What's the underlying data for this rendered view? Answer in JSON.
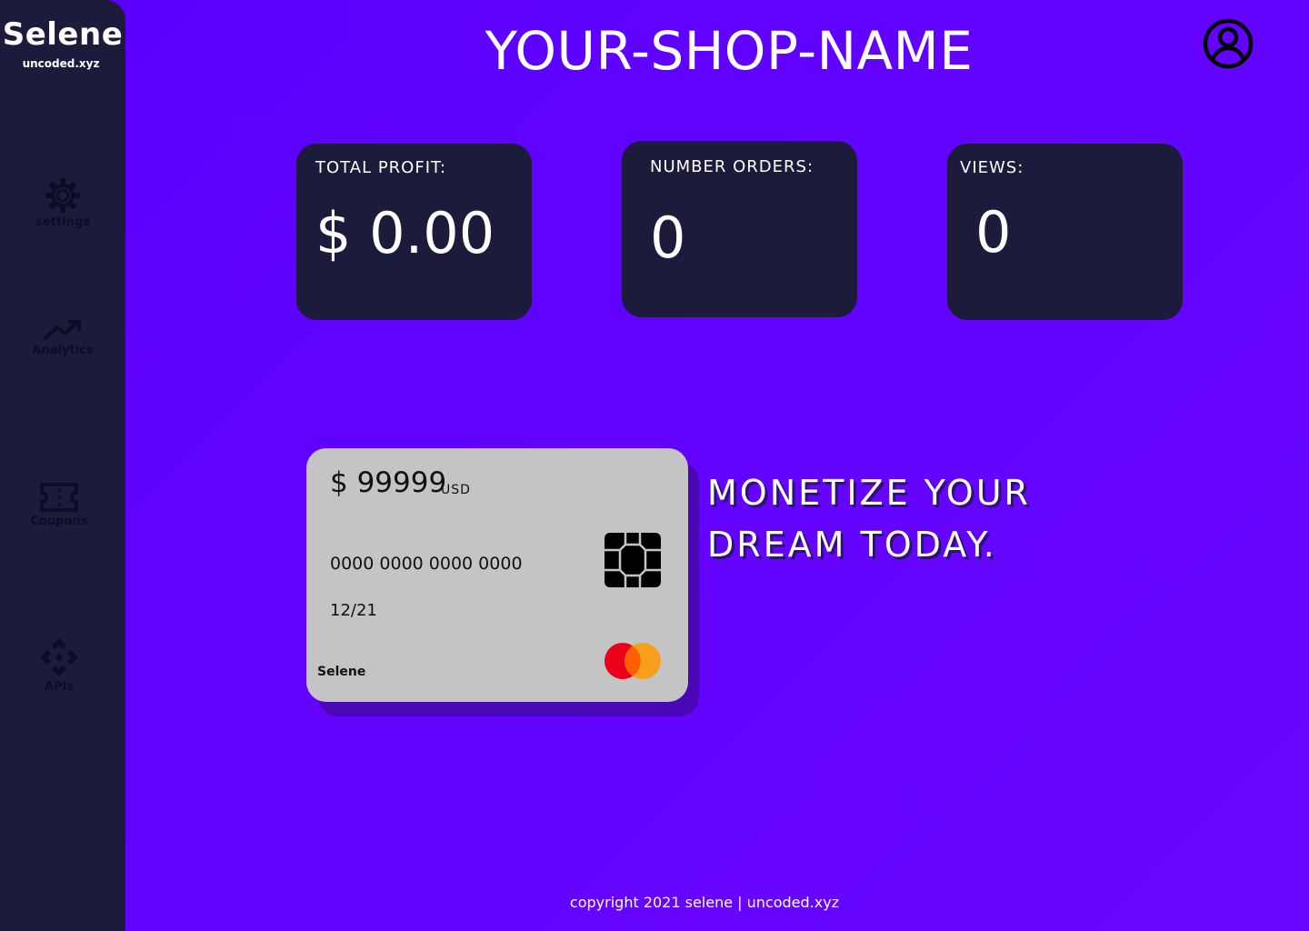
{
  "sidebar": {
    "brand": "Selene",
    "subtitle": "uncoded.xyz",
    "items": [
      {
        "label": "settings",
        "icon": "gear-icon"
      },
      {
        "label": "Analytics",
        "icon": "trending-up-icon"
      },
      {
        "label": "Coupons",
        "icon": "ticket-icon"
      },
      {
        "label": "APIs",
        "icon": "api-icon"
      }
    ]
  },
  "header": {
    "title": "YOUR-SHOP-NAME",
    "profile_icon": "user-circle-icon"
  },
  "stats": [
    {
      "label": "TOTAL PROFIT:",
      "value": "$ 0.00"
    },
    {
      "label": "NUMBER ORDERS:",
      "value": "0"
    },
    {
      "label": "VIEWS:",
      "value": "0"
    }
  ],
  "card": {
    "amount": "$ 99999",
    "currency": "USD",
    "number": "0000 0000 0000 0000",
    "expiry": "12/21",
    "brand": "Selene",
    "chip_icon": "chip-icon",
    "network_logo": "mastercard-logo"
  },
  "tagline": {
    "line1": "MONETIZE YOUR",
    "line2": "DREAM TODAY."
  },
  "footer": {
    "text": "copyright 2021 selene | uncoded.xyz"
  },
  "colors": {
    "background": "#5a00ff",
    "sidebar": "#1c1b3b",
    "card": "#1c1b3b",
    "credit_card": "#c4c4c4",
    "credit_card_shadow": "#4a07b5",
    "mastercard_red": "#eb001b",
    "mastercard_orange": "#f79e1b"
  }
}
